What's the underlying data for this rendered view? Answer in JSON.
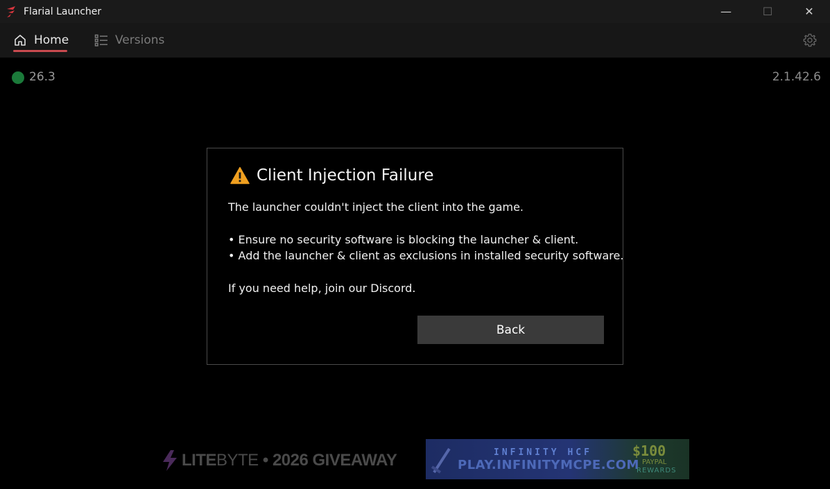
{
  "window": {
    "title": "Flarial Launcher",
    "minimize_glyph": "—",
    "maximize_glyph": "☐",
    "close_glyph": "✕"
  },
  "nav": {
    "tabs": [
      {
        "label": "Home",
        "icon": "home-icon",
        "active": true
      },
      {
        "label": "Versions",
        "icon": "list-icon",
        "active": false
      }
    ],
    "settings_icon": "gear-icon"
  },
  "status": {
    "game_version": "26.3",
    "status_color": "#1b7a3a",
    "launcher_version": "2.1.42.6"
  },
  "dialog": {
    "icon": "warning-icon",
    "title": "Client Injection Failure",
    "line1": "The launcher couldn't inject the client into the game.",
    "bullet1": "• Ensure no security software is blocking the launcher & client.",
    "bullet2": "• Add the launcher & client as exclusions in installed security software.",
    "help": "If you need help, join our Discord.",
    "button_label": "Back"
  },
  "banners": {
    "litebyte": {
      "brand_bold": "LITE",
      "brand_light": "BYTE",
      "separator": " • ",
      "text": "2026 GIVEAWAY"
    },
    "infinity": {
      "top": "INFINITY HCF",
      "main": "PLAY.INFINITYMCPE.COM",
      "prize": "$100",
      "paypal": "PAYPAL",
      "rewards": "REWARDS"
    }
  },
  "colors": {
    "accent": "#c94a4f",
    "background": "#000000",
    "button": "#3a3a3a"
  }
}
